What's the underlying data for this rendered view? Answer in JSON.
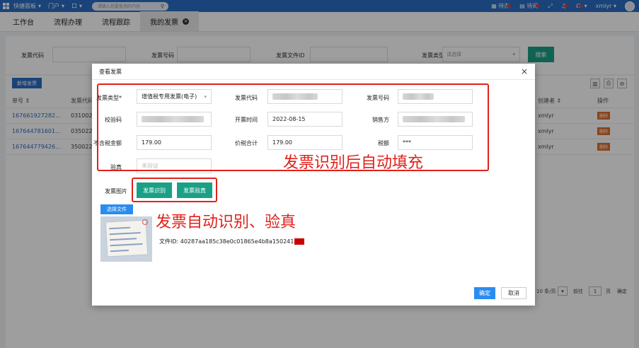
{
  "topbar": {
    "quick_panel": "快捷面板",
    "menu2": "门户",
    "menu3": "口",
    "search_placeholder": "请输入您要查询的内容",
    "todo": "待办",
    "toread": "待阅",
    "user": "xmlyr"
  },
  "tabs": [
    "工作台",
    "流程办理",
    "流程跟踪",
    "我的发票"
  ],
  "filter": {
    "code_label": "发票代码",
    "number_label": "发票号码",
    "fileid_label": "发票文件ID",
    "type_label": "发票类型",
    "type_placeholder": "请选择",
    "search_btn": "搜索"
  },
  "list": {
    "new_btn": "新增发票",
    "col_no": "单号",
    "col_code": "发票代码",
    "col_creator": "创建者",
    "col_ops": "操作",
    "rows": [
      {
        "no": "167661927282...",
        "code": "031002",
        "creator": "xmlyr",
        "op": "删除"
      },
      {
        "no": "167644781601...",
        "code": "035022",
        "creator": "xmlyr",
        "op": "删除"
      },
      {
        "no": "167644779426...",
        "code": "350022",
        "creator": "xmlyr",
        "op": "删除"
      }
    ],
    "pager_size": "10 条/页",
    "pager_goto": "前往",
    "pager_page": "1",
    "pager_unit": "页",
    "pager_confirm": "确定"
  },
  "modal": {
    "title": "查看发票",
    "type_label": "发票类型*",
    "type_value": "增值税专用发票(电子)",
    "code_label": "发票代码",
    "number_label": "发票号码",
    "check_label": "校验码",
    "date_label": "开票时间",
    "date_value": "2022-08-15",
    "seller_label": "销售方",
    "amount_label": "不含税金额",
    "amount_value": "179.00",
    "total_label": "价税合计",
    "total_value": "179.00",
    "tax_label": "税额",
    "tax_value": "***",
    "verify_label": "验真",
    "verify_placeholder": "未验证",
    "image_label": "发票图片",
    "recognize_btn": "发票识别",
    "verify_btn": "发票验真",
    "choose_file_btn": "选择文件",
    "fileid_text": "文件ID: 40287aa185c38e0c01865e4b8a150241",
    "ok_btn": "确定",
    "cancel_btn": "取消"
  },
  "annotations": {
    "autofill": "发票识别后自动填充",
    "auto_recognize": "发票自动识别、验真"
  },
  "colors": {
    "primary": "#2b6cc4",
    "teal": "#1aa085",
    "annotation_red": "#e0211b",
    "delete_orange": "#e06c2a"
  }
}
